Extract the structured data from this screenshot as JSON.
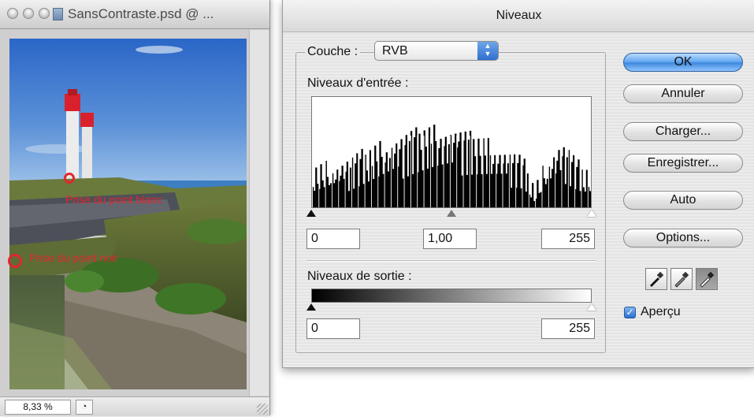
{
  "document_window": {
    "title": "SansContraste.psd @ ...",
    "zoom": "8,33 %",
    "annotations": {
      "white_point_label": "Prise du point blanc",
      "black_point_label": "Prise du point noir"
    }
  },
  "levels_dialog": {
    "title": "Niveaux",
    "channel_label": "Couche :",
    "channel_value": "RVB",
    "input_levels_label": "Niveaux d'entrée :",
    "input_black": "0",
    "input_gamma": "1,00",
    "input_white": "255",
    "input_gamma_fraction": 0.5,
    "output_levels_label": "Niveaux de sortie :",
    "output_black": "0",
    "output_white": "255",
    "buttons": {
      "ok": "OK",
      "cancel": "Annuler",
      "load": "Charger...",
      "save": "Enregistrer...",
      "auto": "Auto",
      "options": "Options..."
    },
    "preview_label": "Aperçu",
    "preview_checked": true,
    "eyedroppers": [
      "black-point-eyedropper-icon",
      "gray-point-eyedropper-icon",
      "white-point-eyedropper-icon"
    ],
    "active_eyedropper": "white-point-eyedropper-icon"
  },
  "colors": {
    "annotation_red": "#e3262d",
    "default_button_blue": "#3d86dc",
    "checkbox_blue": "#2c6ed1"
  }
}
